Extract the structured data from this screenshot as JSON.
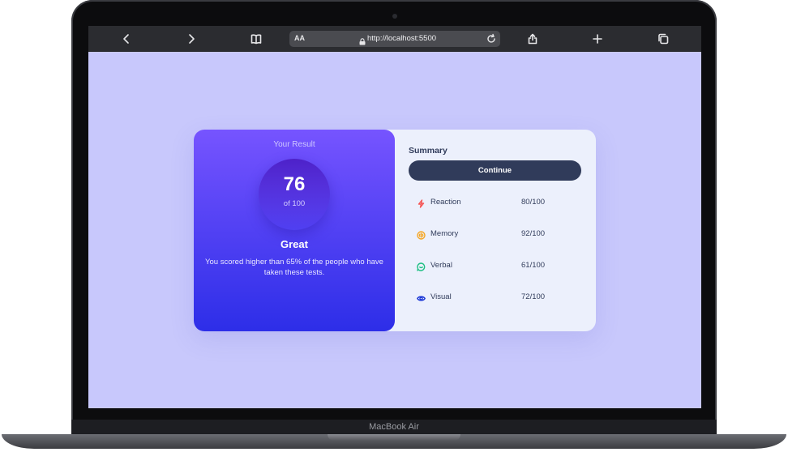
{
  "device": {
    "label": "MacBook Air"
  },
  "browser": {
    "text_size_label": "AA",
    "url": "http://localhost:5500"
  },
  "result": {
    "title": "Your Result",
    "score": "76",
    "score_of": "of 100",
    "rating": "Great",
    "description": "You scored higher than 65% of the people who have taken these tests."
  },
  "summary": {
    "title": "Summary",
    "continue_label": "Continue",
    "items": [
      {
        "label": "Reaction",
        "score": "80/100",
        "icon": "lightning-icon",
        "color": "#f55555"
      },
      {
        "label": "Memory",
        "score": "92/100",
        "icon": "brain-icon",
        "color": "#f5a623"
      },
      {
        "label": "Verbal",
        "score": "61/100",
        "icon": "speech-bubble-icon",
        "color": "#1dbf82"
      },
      {
        "label": "Visual",
        "score": "72/100",
        "icon": "eye-icon",
        "color": "#1b37d6"
      }
    ]
  },
  "colors": {
    "page_bg": "#c8c8fc",
    "result_gradient_top": "#7654ff",
    "result_gradient_bottom": "#2d2ee8",
    "dark_navy": "#303b5a",
    "summary_bg": "#ecf0fc"
  }
}
